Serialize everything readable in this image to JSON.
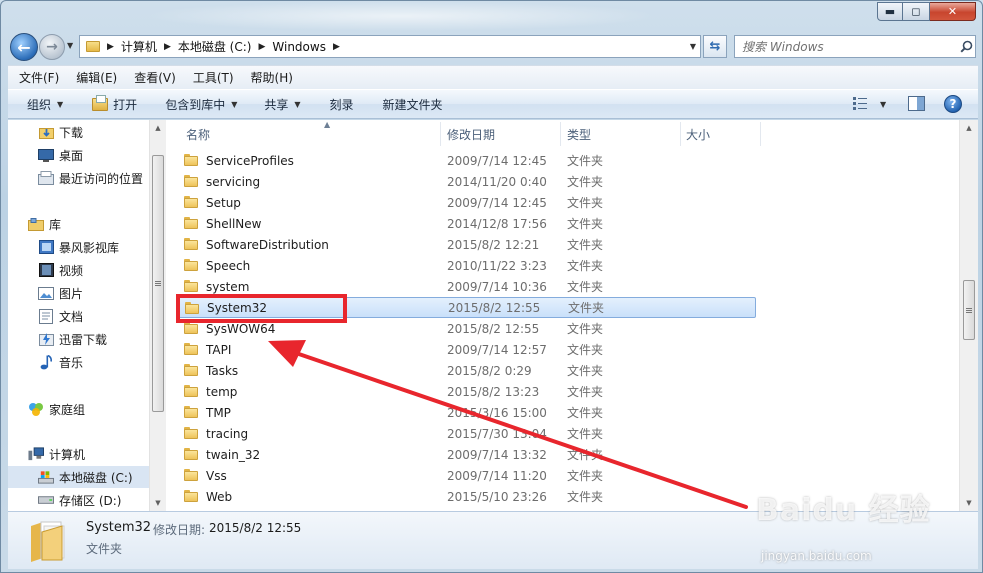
{
  "window": {
    "caption": {
      "minimize": "▬",
      "maximize": "◻",
      "close": "✕"
    }
  },
  "address_bar": {
    "crumbs": [
      "计算机",
      "本地磁盘 (C:)",
      "Windows"
    ]
  },
  "search": {
    "placeholder": "搜索 Windows"
  },
  "menubar": [
    "文件(F)",
    "编辑(E)",
    "查看(V)",
    "工具(T)",
    "帮助(H)"
  ],
  "toolbar": {
    "organize": "组织",
    "open": "打开",
    "include_library": "包含到库中",
    "share": "共享",
    "burn": "刻录",
    "new_folder": "新建文件夹"
  },
  "nav_pane": {
    "items": [
      {
        "label": "下载",
        "icon": "download-folder-icon"
      },
      {
        "label": "桌面",
        "icon": "desktop-icon"
      },
      {
        "label": "最近访问的位置",
        "icon": "recent-places-icon"
      },
      {
        "label": "库",
        "icon": "library-icon"
      },
      {
        "label": "暴风影视库",
        "icon": "video-library-icon"
      },
      {
        "label": "视频",
        "icon": "videos-icon"
      },
      {
        "label": "图片",
        "icon": "pictures-icon"
      },
      {
        "label": "文档",
        "icon": "documents-icon"
      },
      {
        "label": "迅雷下载",
        "icon": "thunder-download-icon"
      },
      {
        "label": "音乐",
        "icon": "music-icon"
      },
      {
        "label": "家庭组",
        "icon": "homegroup-icon"
      },
      {
        "label": "计算机",
        "icon": "computer-icon"
      },
      {
        "label": "本地磁盘 (C:)",
        "icon": "system-drive-icon",
        "selected": true
      },
      {
        "label": "存储区 (D:)",
        "icon": "drive-icon"
      }
    ]
  },
  "file_list": {
    "columns": [
      "名称",
      "修改日期",
      "类型",
      "大小"
    ],
    "rows": [
      {
        "name": "ServiceProfiles",
        "date": "2009/7/14 12:45",
        "type": "文件夹"
      },
      {
        "name": "servicing",
        "date": "2014/11/20 0:40",
        "type": "文件夹"
      },
      {
        "name": "Setup",
        "date": "2009/7/14 12:45",
        "type": "文件夹"
      },
      {
        "name": "ShellNew",
        "date": "2014/12/8 17:56",
        "type": "文件夹"
      },
      {
        "name": "SoftwareDistribution",
        "date": "2015/8/2 12:21",
        "type": "文件夹"
      },
      {
        "name": "Speech",
        "date": "2010/11/22 3:23",
        "type": "文件夹"
      },
      {
        "name": "system",
        "date": "2009/7/14 10:36",
        "type": "文件夹"
      },
      {
        "name": "System32",
        "date": "2015/8/2 12:55",
        "type": "文件夹",
        "selected": true
      },
      {
        "name": "SysWOW64",
        "date": "2015/8/2 12:55",
        "type": "文件夹"
      },
      {
        "name": "TAPI",
        "date": "2009/7/14 12:57",
        "type": "文件夹"
      },
      {
        "name": "Tasks",
        "date": "2015/8/2 0:29",
        "type": "文件夹"
      },
      {
        "name": "temp",
        "date": "2015/8/2 13:23",
        "type": "文件夹"
      },
      {
        "name": "TMP",
        "date": "2015/3/16 15:00",
        "type": "文件夹"
      },
      {
        "name": "tracing",
        "date": "2015/7/30 13:04",
        "type": "文件夹"
      },
      {
        "name": "twain_32",
        "date": "2009/7/14 13:32",
        "type": "文件夹"
      },
      {
        "name": "Vss",
        "date": "2009/7/14 11:20",
        "type": "文件夹"
      },
      {
        "name": "Web",
        "date": "2015/5/10 23:26",
        "type": "文件夹"
      }
    ]
  },
  "details_pane": {
    "name": "System32",
    "date_label": "修改日期:",
    "date_value": "2015/8/2 12:55",
    "type": "文件夹"
  },
  "watermark": {
    "brand": "Baidu 经验",
    "url": "jingyan.baidu.com"
  },
  "colors": {
    "annotation": "#e8262d",
    "selection": "#cde3fb",
    "accent": "#2c6db8"
  }
}
